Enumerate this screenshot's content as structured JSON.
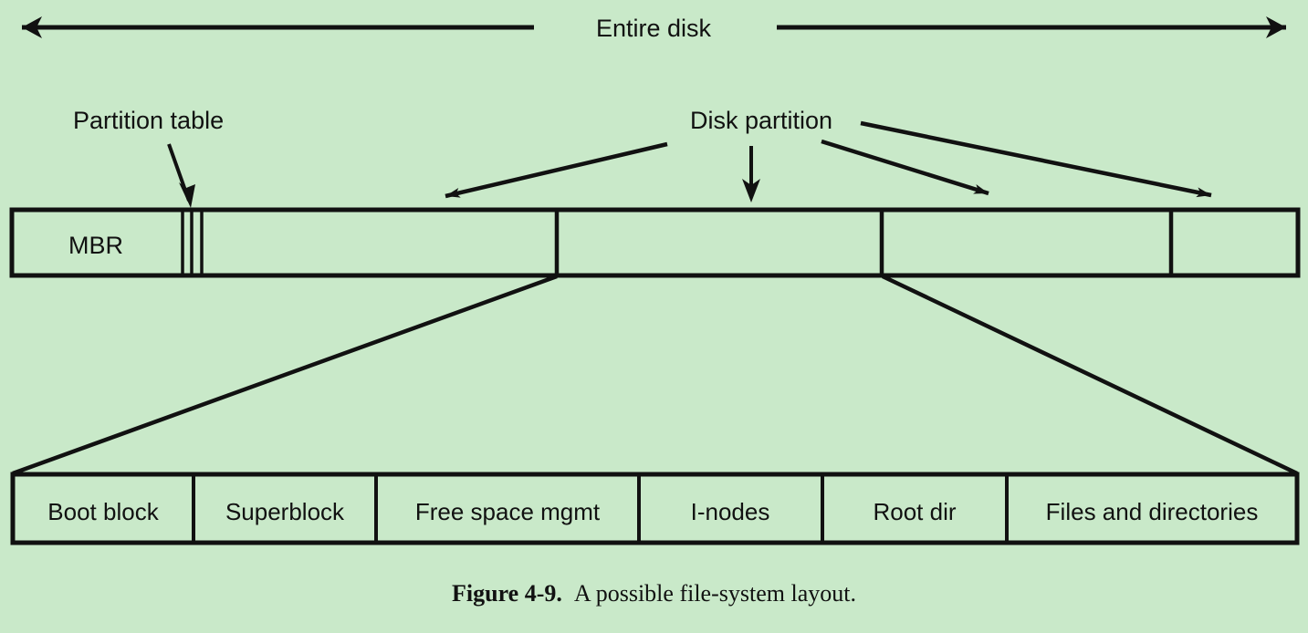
{
  "figure": {
    "caption_label": "Figure 4-9.",
    "caption_text": "A possible file-system layout.",
    "background_color": "#c9e9c9",
    "line_color": "#111111"
  },
  "annotations": {
    "entire_disk": "Entire disk",
    "partition_table": "Partition table",
    "disk_partition": "Disk partition"
  },
  "disk_bar": {
    "mbr_label": "MBR",
    "partition_table_lines": 3,
    "partitions": [
      "",
      "",
      "",
      ""
    ]
  },
  "partition_detail": {
    "blocks": [
      {
        "label": "Boot block"
      },
      {
        "label": "Superblock"
      },
      {
        "label": "Free space mgmt"
      },
      {
        "label": "I-nodes"
      },
      {
        "label": "Root dir"
      },
      {
        "label": "Files and directories"
      }
    ]
  }
}
